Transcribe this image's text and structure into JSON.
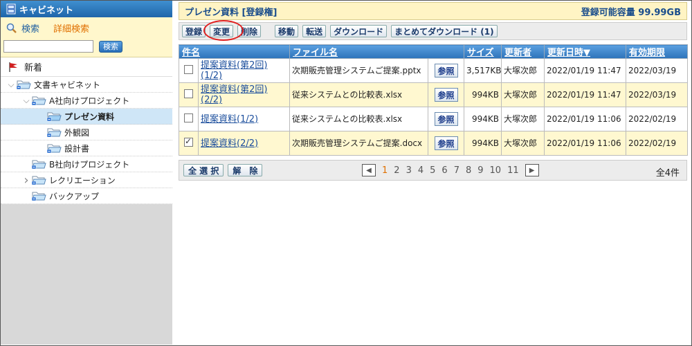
{
  "sidebar": {
    "title": "キャビネット",
    "search_link": "検索",
    "advanced_search_link": "詳細検索",
    "search_input_value": "",
    "search_button": "検索",
    "new_label": "新着",
    "tree": [
      {
        "label": "文書キャビネット",
        "indent": 0,
        "toggle": "v",
        "selected": false
      },
      {
        "label": "A社向けプロジェクト",
        "indent": 1,
        "toggle": "v",
        "selected": false
      },
      {
        "label": "プレゼン資料",
        "indent": 2,
        "toggle": "",
        "selected": true
      },
      {
        "label": "外観図",
        "indent": 2,
        "toggle": "",
        "selected": false
      },
      {
        "label": "設計書",
        "indent": 2,
        "toggle": "",
        "selected": false
      },
      {
        "label": "B社向けプロジェクト",
        "indent": 1,
        "toggle": "",
        "selected": false
      },
      {
        "label": "レクリエーション",
        "indent": 1,
        "toggle": ">",
        "selected": false
      },
      {
        "label": "バックアップ",
        "indent": 1,
        "toggle": "",
        "selected": false
      }
    ]
  },
  "main": {
    "title": "プレゼン資料 [登録権]",
    "capacity": "登録可能容量 99.99GB",
    "toolbar": {
      "register": "登録",
      "change": "変更",
      "delete": "削除",
      "move": "移動",
      "transfer": "転送",
      "download": "ダウンロード",
      "bulk_download": "まとめてダウンロード (1)"
    },
    "columns": {
      "subject": "件名",
      "filename": "ファイル名",
      "size": "サイズ",
      "updater": "更新者",
      "updated": "更新日時▼",
      "expiry": "有効期限"
    },
    "rows": [
      {
        "checked": false,
        "subject": "提案資料(第2回)(1/2)",
        "filename": "次期販売管理システムご提案.pptx",
        "ref": "参照",
        "size": "3,517KB",
        "updater": "大塚次郎",
        "updated": "2022/01/19 11:47",
        "expiry": "2022/03/19"
      },
      {
        "checked": false,
        "subject": "提案資料(第2回)(2/2)",
        "filename": "従来システムとの比較表.xlsx",
        "ref": "参照",
        "size": "994KB",
        "updater": "大塚次郎",
        "updated": "2022/01/19 11:47",
        "expiry": "2022/03/19"
      },
      {
        "checked": false,
        "subject": "提案資料(1/2)",
        "filename": "従来システムとの比較表.xlsx",
        "ref": "参照",
        "size": "994KB",
        "updater": "大塚次郎",
        "updated": "2022/01/19 11:06",
        "expiry": "2022/02/19"
      },
      {
        "checked": true,
        "subject": "提案資料(2/2)",
        "filename": "次期販売管理システムご提案.docx",
        "ref": "参照",
        "size": "994KB",
        "updater": "大塚次郎",
        "updated": "2022/01/19 11:06",
        "expiry": "2022/02/19"
      }
    ],
    "pager": {
      "select_all": "全 選 択",
      "deselect": "解　除",
      "pages": [
        "1",
        "2",
        "3",
        "4",
        "5",
        "6",
        "7",
        "8",
        "9",
        "10",
        "11"
      ],
      "current": "1",
      "total": "全4件"
    },
    "colors": {
      "accent": "#2e73ba",
      "highlight": "#fff8d0",
      "callout": "#e02020"
    }
  }
}
